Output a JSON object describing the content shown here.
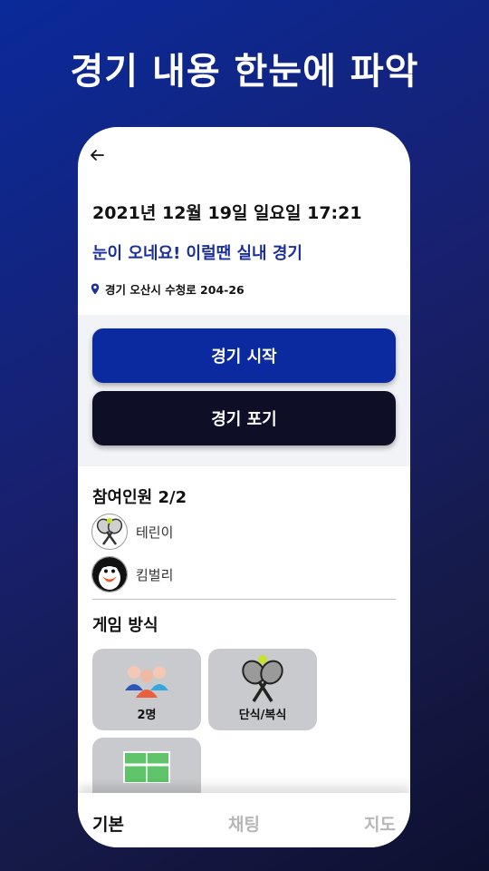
{
  "headline": "경기 내용 한눈에 파악",
  "match": {
    "datetime": "2021년 12월 19일 일요일 17:21",
    "subtitle": "눈이 오네요! 이럴땐 실내 경기",
    "address": "경기 오산시 수청로 204-26"
  },
  "actions": {
    "start_label": "경기 시작",
    "quit_label": "경기 포기"
  },
  "participants": {
    "title": "참여인원 2/2",
    "items": [
      {
        "name": "테린이",
        "avatar": "tennis-rackets-avatar"
      },
      {
        "name": "킴벌리",
        "avatar": "penguin-avatar"
      }
    ]
  },
  "game": {
    "title": "게임 방식",
    "cards": [
      {
        "label": "2명",
        "icon": "people-group-icon"
      },
      {
        "label": "단식/복식",
        "icon": "tennis-rackets-icon"
      },
      {
        "label": "",
        "icon": "tennis-court-icon"
      }
    ]
  },
  "nav": {
    "basic": "기본",
    "chat": "채팅",
    "map": "지도"
  },
  "colors": {
    "accent": "#0b2aa0",
    "dark_button": "#0e0f26",
    "subtitle": "#1b2f9b"
  }
}
